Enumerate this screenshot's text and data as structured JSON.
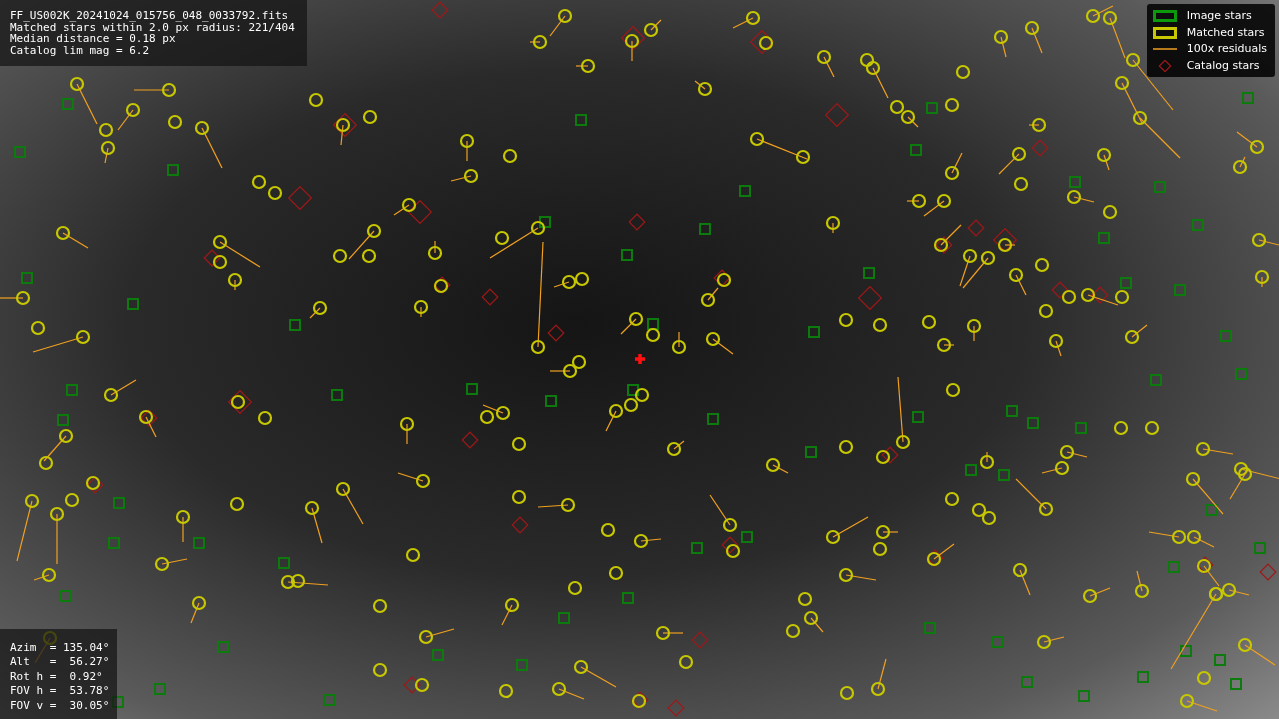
{
  "info_box": {
    "lines": [
      "FF_US002K_20241024_015756_048_0033792.fits",
      "Matched stars within 2.0 px radius: 221/404",
      "Median distance = 0.18 px",
      "Catalog lim mag = 6.2"
    ]
  },
  "legend": {
    "items": [
      {
        "label": "Image stars",
        "kind": "image"
      },
      {
        "label": "Matched stars",
        "kind": "matched"
      },
      {
        "label": "100x residuals",
        "kind": "residual"
      },
      {
        "label": "Catalog stars",
        "kind": "catalog"
      }
    ]
  },
  "pointing_box": {
    "lines": [
      "Azim  = 135.04°",
      "Alt   =  56.27°",
      "Rot h =  0.92°",
      "FOV h =  53.78°",
      "FOV v =  30.05°"
    ]
  }
}
